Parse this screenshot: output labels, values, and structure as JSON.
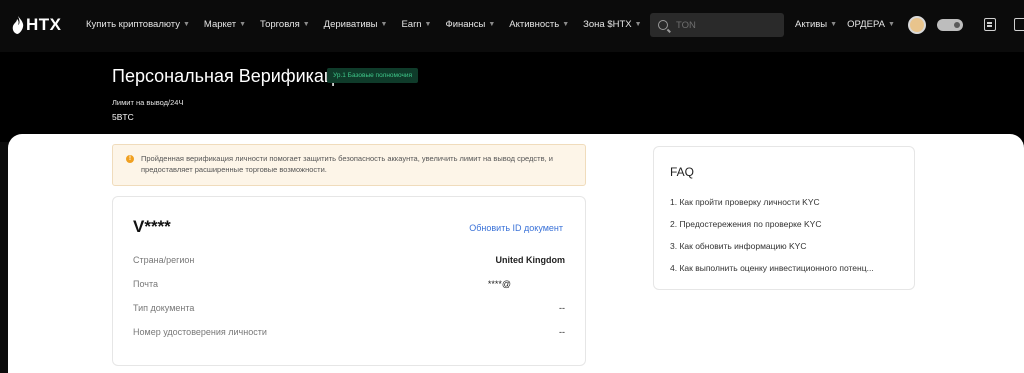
{
  "brand": {
    "name": "HTX"
  },
  "nav": {
    "items": [
      {
        "label": "Купить криптовалюту"
      },
      {
        "label": "Маркет"
      },
      {
        "label": "Торговля"
      },
      {
        "label": "Деривативы"
      },
      {
        "label": "Earn"
      },
      {
        "label": "Финансы"
      },
      {
        "label": "Активность"
      },
      {
        "label": "Зона $HTX"
      }
    ],
    "search_placeholder": "TON",
    "right_items": [
      {
        "label": "Активы"
      },
      {
        "label": "ОРДЕРА"
      }
    ]
  },
  "hero": {
    "title": "Персональная Верификация",
    "level_badge": "Ур.1 Базовые полномочия",
    "limit_label": "Лимит на вывод/24Ч",
    "limit_value": "5BTC"
  },
  "notice": {
    "text": "Пройденная верификация личности помогает защитить безопасность аккаунта, увеличить лимит на вывод средств, и предоставляет расширенные торговые возможности."
  },
  "identity": {
    "name": "V****",
    "update_link": "Обновить ID документ",
    "rows": [
      {
        "label": "Страна/регион",
        "value": "United Kingdom"
      },
      {
        "label": "Почта",
        "value": "****@"
      },
      {
        "label": "Тип документа",
        "value": "--"
      },
      {
        "label": "Номер удостоверения личности",
        "value": "--"
      }
    ]
  },
  "faq": {
    "title": "FAQ",
    "items": [
      {
        "label": "1. Как пройти проверку личности KYC"
      },
      {
        "label": "2. Предостережения по проверке KYC"
      },
      {
        "label": "3. Как обновить информацию KYC"
      },
      {
        "label": "4. Как выполнить оценку инвестиционного потенц..."
      }
    ]
  },
  "colors": {
    "accent_link": "#3a72d8",
    "badge_green": "#3fc88a",
    "warning": "#f0a020"
  }
}
